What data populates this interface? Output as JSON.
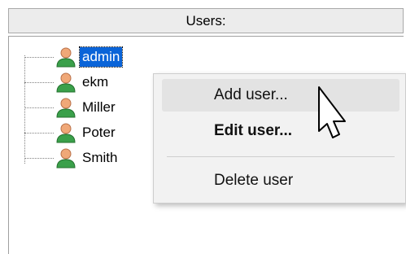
{
  "header": {
    "title": "Users:"
  },
  "users": [
    {
      "name": "admin",
      "selected": true
    },
    {
      "name": "ekm",
      "selected": false
    },
    {
      "name": "Miller",
      "selected": false
    },
    {
      "name": "Poter",
      "selected": false
    },
    {
      "name": "Smith",
      "selected": false
    }
  ],
  "context_menu": {
    "items": [
      {
        "label": "Add user...",
        "bold": false,
        "hover": true
      },
      {
        "label": "Edit user...",
        "bold": true,
        "hover": false
      },
      {
        "label": "Delete user",
        "bold": false,
        "hover": false
      }
    ]
  },
  "icons": {
    "user": "user-icon",
    "cursor": "mouse-pointer-icon"
  },
  "colors": {
    "selection": "#0a64d8",
    "user_head": "#f0a878",
    "user_body": "#3aa04a"
  }
}
